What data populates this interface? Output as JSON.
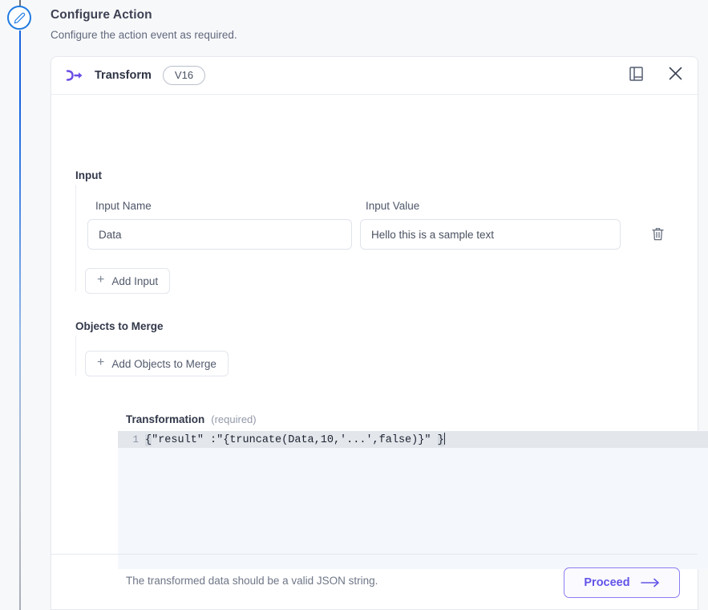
{
  "stepper": {
    "node_icon": "pencil-edit-icon",
    "accent_color": "#1f7ae0"
  },
  "page": {
    "title": "Configure Action",
    "subtitle": "Configure the action event as required."
  },
  "card": {
    "icon": "transform-icon",
    "title": "Transform",
    "version_badge": "V16",
    "header_actions": [
      {
        "icon": "notes-panel-icon",
        "name": "notes-panel-button"
      },
      {
        "icon": "close-icon",
        "name": "close-button"
      }
    ]
  },
  "input_section": {
    "heading": "Input",
    "name_label": "Input Name",
    "value_label": "Input Value",
    "name_value": "Data",
    "value_value": "Hello this is a sample text",
    "name_placeholder": "Input Name",
    "value_placeholder": "Input Value",
    "delete_icon": "trash-icon",
    "add_button": "Add Input",
    "add_icon": "plus-icon"
  },
  "merge_section": {
    "heading": "Objects to Merge",
    "add_button": "Add Objects to Merge",
    "add_icon": "plus-icon"
  },
  "transformation": {
    "label": "Transformation",
    "required_hint": "(required)",
    "line_number": "1",
    "code_open_brace": "{",
    "code_body": "\"result\" :\"{truncate(Data,10,'...',false)}\" ",
    "code_close_brace": "}",
    "helper_text": "The transformed data should be a valid JSON string."
  },
  "footer": {
    "proceed_label": "Proceed",
    "proceed_icon": "arrow-right-icon",
    "accent_color": "#6254e8"
  }
}
